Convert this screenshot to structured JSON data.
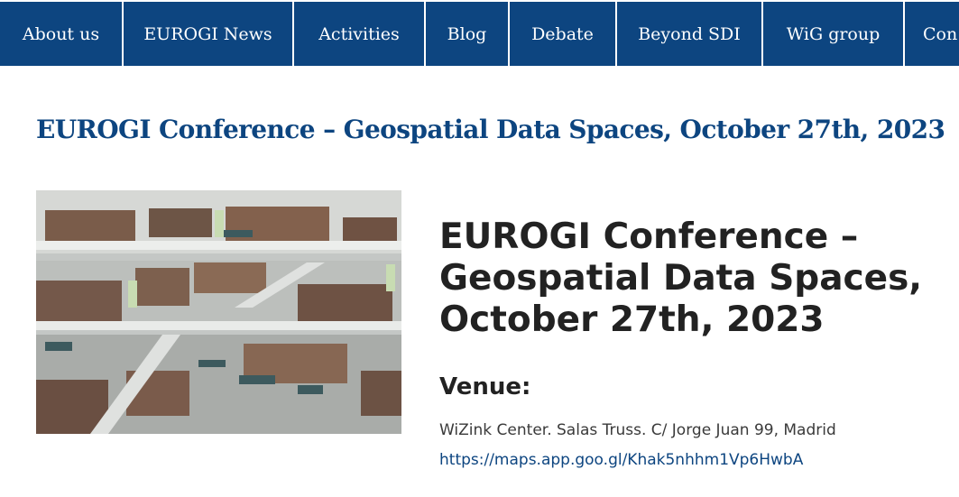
{
  "nav": {
    "items": [
      {
        "label": "About us"
      },
      {
        "label": "EUROGI News"
      },
      {
        "label": "Activities"
      },
      {
        "label": "Blog"
      },
      {
        "label": "Debate"
      },
      {
        "label": "Beyond SDI"
      },
      {
        "label": "WiG group"
      },
      {
        "label": "Con"
      }
    ],
    "color": "#0d4580"
  },
  "page": {
    "title": "EUROGI Conference – Geospatial Data Spaces, October 27th, 2023"
  },
  "event": {
    "image": "library-interior-photo",
    "title": "EUROGI Conference – Geospatial Data Spaces, October 27th, 2023",
    "venue_heading": "Venue:",
    "venue_address": "WiZink Center. Salas Truss. C/ Jorge Juan 99, Madrid",
    "venue_link": "https://maps.app.goo.gl/Khak5nhhm1Vp6HwbA"
  }
}
